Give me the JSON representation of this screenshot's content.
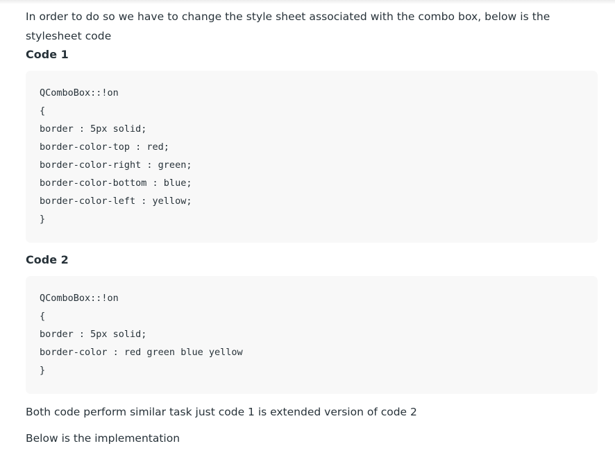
{
  "intro_text": "In order to do so we have to change the style sheet associated with the combo box, below is the stylesheet code",
  "code1": {
    "heading": "Code 1",
    "lines": [
      "QComboBox::!on",
      "{",
      "border : 5px solid;",
      "border-color-top : red;",
      "border-color-right : green;",
      "border-color-bottom : blue;",
      "border-color-left : yellow;",
      "}"
    ]
  },
  "code2": {
    "heading": "Code 2",
    "lines": [
      "QComboBox::!on",
      "{",
      "border : 5px solid;",
      "border-color : red green blue yellow",
      "}"
    ]
  },
  "summary_text": "Both code perform similar task just code 1 is extended version of code 2",
  "implementation_text": "Below is the implementation",
  "colors": {
    "code_background": "#f8f8f8",
    "text": "#273239"
  }
}
